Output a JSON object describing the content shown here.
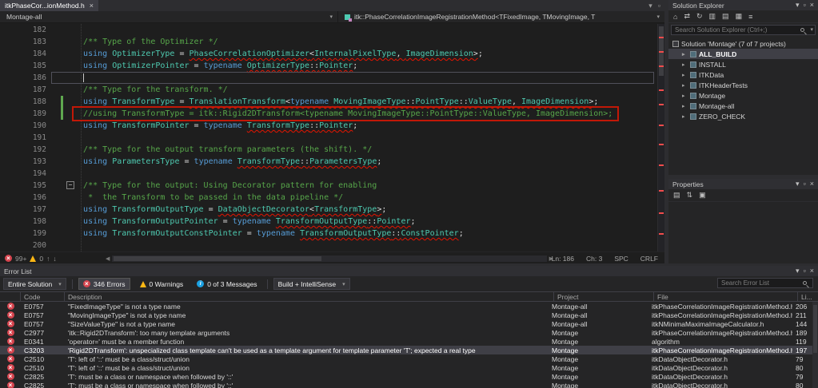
{
  "colors": {
    "error": "#D6444E",
    "warning": "#FDB714",
    "info": "#1BA1E2",
    "comment": "#57A64A",
    "keyword": "#569CD6",
    "type": "#4EC9B0",
    "change_bar": "#5FA84F",
    "annotation_box": "#C21807",
    "selection": "#3F3F46"
  },
  "icons": {
    "close": "×",
    "chevron_down": "▾",
    "chevron_left": "◀",
    "chevron_right": "▶",
    "expander": "▸",
    "up": "↑",
    "down": "↓",
    "minus": "−",
    "pin": "▫"
  },
  "editor": {
    "tab": {
      "title": "itkPhaseCor...ionMethod.h"
    },
    "navbar": {
      "project": "Montage-all",
      "scope": "itk::PhaseCorrelationImageRegistrationMethod<TFixedImage, TMovingImage, T"
    },
    "status": {
      "errors_badge": "99+",
      "warnings_badge": "0",
      "ln": "Ln: 186",
      "ch": "Ch: 3",
      "enc": "SPC",
      "eol": "CRLF"
    },
    "lines": [
      {
        "n": 182,
        "tokens": []
      },
      {
        "n": 183,
        "tokens": [
          {
            "t": "  ",
            "c": "pl"
          },
          {
            "t": "/** Type of the Optimizer */",
            "c": "cm"
          }
        ]
      },
      {
        "n": 184,
        "tokens": [
          {
            "t": "  ",
            "c": "pl"
          },
          {
            "t": "using",
            "c": "kw"
          },
          {
            "t": " ",
            "c": "pl"
          },
          {
            "t": "OptimizerType",
            "c": "ty"
          },
          {
            "t": " = ",
            "c": "pl"
          },
          {
            "t": "PhaseCorrelationOptimizer",
            "c": "ty sq"
          },
          {
            "t": "<",
            "c": "pl sq"
          },
          {
            "t": "InternalPixelType",
            "c": "ty sq"
          },
          {
            "t": ", ",
            "c": "pl sq"
          },
          {
            "t": "ImageDimension",
            "c": "ty sq"
          },
          {
            "t": ">",
            "c": "pl sq"
          },
          {
            "t": ";",
            "c": "pl"
          }
        ]
      },
      {
        "n": 185,
        "tokens": [
          {
            "t": "  ",
            "c": "pl"
          },
          {
            "t": "using",
            "c": "kw"
          },
          {
            "t": " ",
            "c": "pl"
          },
          {
            "t": "OptimizerPointer",
            "c": "ty"
          },
          {
            "t": " = ",
            "c": "pl"
          },
          {
            "t": "typename",
            "c": "kw"
          },
          {
            "t": " ",
            "c": "pl"
          },
          {
            "t": "OptimizerType",
            "c": "ty sq"
          },
          {
            "t": "::",
            "c": "pl sq"
          },
          {
            "t": "Pointer",
            "c": "ty sq"
          },
          {
            "t": ";",
            "c": "pl"
          }
        ]
      },
      {
        "n": 186,
        "current": true,
        "tokens": [
          {
            "t": "  ",
            "c": "pl"
          }
        ]
      },
      {
        "n": 187,
        "tokens": [
          {
            "t": "  ",
            "c": "pl"
          },
          {
            "t": "/** Type for the transform. */",
            "c": "cm"
          }
        ]
      },
      {
        "n": 188,
        "changed": true,
        "tokens": [
          {
            "t": "  ",
            "c": "pl"
          },
          {
            "t": "using",
            "c": "kw"
          },
          {
            "t": " ",
            "c": "pl"
          },
          {
            "t": "TransformType",
            "c": "ty"
          },
          {
            "t": " = ",
            "c": "pl"
          },
          {
            "t": "TranslationTransform",
            "c": "ty sq"
          },
          {
            "t": "<",
            "c": "pl sq"
          },
          {
            "t": "typename",
            "c": "kw sq"
          },
          {
            "t": " ",
            "c": "pl sq"
          },
          {
            "t": "MovingImageType",
            "c": "ty sq"
          },
          {
            "t": "::",
            "c": "pl sq"
          },
          {
            "t": "PointType",
            "c": "ty sq"
          },
          {
            "t": "::",
            "c": "pl sq"
          },
          {
            "t": "ValueType",
            "c": "ty sq"
          },
          {
            "t": ", ",
            "c": "pl sq"
          },
          {
            "t": "ImageDimension",
            "c": "ty sq"
          },
          {
            "t": ">",
            "c": "pl sq"
          },
          {
            "t": ";",
            "c": "pl"
          }
        ]
      },
      {
        "n": 189,
        "changed": true,
        "redbox": true,
        "tokens": [
          {
            "t": "  ",
            "c": "pl"
          },
          {
            "t": "//using TransformType = itk::Rigid2DTransform<typename MovingImageType::PointType::ValueType, ImageDimension>;",
            "c": "cm"
          }
        ]
      },
      {
        "n": 190,
        "tokens": [
          {
            "t": "  ",
            "c": "pl"
          },
          {
            "t": "using",
            "c": "kw"
          },
          {
            "t": " ",
            "c": "pl"
          },
          {
            "t": "TransformPointer",
            "c": "ty"
          },
          {
            "t": " = ",
            "c": "pl"
          },
          {
            "t": "typename",
            "c": "kw"
          },
          {
            "t": " ",
            "c": "pl"
          },
          {
            "t": "TransformType",
            "c": "ty sq"
          },
          {
            "t": "::",
            "c": "pl sq"
          },
          {
            "t": "Pointer",
            "c": "ty sq"
          },
          {
            "t": ";",
            "c": "pl"
          }
        ]
      },
      {
        "n": 191,
        "tokens": []
      },
      {
        "n": 192,
        "tokens": [
          {
            "t": "  ",
            "c": "pl"
          },
          {
            "t": "/** Type for the output transform parameters (the shift). */",
            "c": "cm"
          }
        ]
      },
      {
        "n": 193,
        "tokens": [
          {
            "t": "  ",
            "c": "pl"
          },
          {
            "t": "using",
            "c": "kw"
          },
          {
            "t": " ",
            "c": "pl"
          },
          {
            "t": "ParametersType",
            "c": "ty"
          },
          {
            "t": " = ",
            "c": "pl"
          },
          {
            "t": "typename",
            "c": "kw"
          },
          {
            "t": " ",
            "c": "pl"
          },
          {
            "t": "TransformType",
            "c": "ty sq"
          },
          {
            "t": "::",
            "c": "pl sq"
          },
          {
            "t": "ParametersType",
            "c": "ty sq"
          },
          {
            "t": ";",
            "c": "pl"
          }
        ]
      },
      {
        "n": 194,
        "tokens": []
      },
      {
        "n": 195,
        "fold": true,
        "tokens": [
          {
            "t": "  ",
            "c": "pl"
          },
          {
            "t": "/** Type for the output: Using Decorator pattern for enabling",
            "c": "cm"
          }
        ]
      },
      {
        "n": 196,
        "tokens": [
          {
            "t": "  ",
            "c": "pl"
          },
          {
            "t": " *  the Transform to be passed in the data pipeline */",
            "c": "cm"
          }
        ]
      },
      {
        "n": 197,
        "tokens": [
          {
            "t": "  ",
            "c": "pl"
          },
          {
            "t": "using",
            "c": "kw"
          },
          {
            "t": " ",
            "c": "pl"
          },
          {
            "t": "TransformOutputType",
            "c": "ty"
          },
          {
            "t": " = ",
            "c": "pl"
          },
          {
            "t": "DataObjectDecorator",
            "c": "ty sq"
          },
          {
            "t": "<",
            "c": "pl sq"
          },
          {
            "t": "TransformType",
            "c": "ty sq"
          },
          {
            "t": ">",
            "c": "pl sq"
          },
          {
            "t": ";",
            "c": "pl"
          }
        ]
      },
      {
        "n": 198,
        "tokens": [
          {
            "t": "  ",
            "c": "pl"
          },
          {
            "t": "using",
            "c": "kw"
          },
          {
            "t": " ",
            "c": "pl"
          },
          {
            "t": "TransformOutputPointer",
            "c": "ty"
          },
          {
            "t": " = ",
            "c": "pl"
          },
          {
            "t": "typename",
            "c": "kw"
          },
          {
            "t": " ",
            "c": "pl"
          },
          {
            "t": "TransformOutputType",
            "c": "ty sq"
          },
          {
            "t": "::",
            "c": "pl sq"
          },
          {
            "t": "Pointer",
            "c": "ty sq"
          },
          {
            "t": ";",
            "c": "pl"
          }
        ]
      },
      {
        "n": 199,
        "tokens": [
          {
            "t": "  ",
            "c": "pl"
          },
          {
            "t": "using",
            "c": "kw"
          },
          {
            "t": " ",
            "c": "pl"
          },
          {
            "t": "TransformOutputConstPointer",
            "c": "ty"
          },
          {
            "t": " = ",
            "c": "pl"
          },
          {
            "t": "typename",
            "c": "kw"
          },
          {
            "t": " ",
            "c": "pl"
          },
          {
            "t": "TransformOutputType",
            "c": "ty sq"
          },
          {
            "t": "::",
            "c": "pl sq"
          },
          {
            "t": "ConstPointer",
            "c": "ty sq"
          },
          {
            "t": ";",
            "c": "pl"
          }
        ]
      },
      {
        "n": 200,
        "tokens": []
      }
    ]
  },
  "solution_explorer": {
    "title": "Solution Explorer",
    "search_placeholder": "Search Solution Explorer (Ctrl+;)",
    "root": "Solution 'Montage' (7 of 7 projects)",
    "title_icons": [
      {
        "name": "window-position-icon",
        "glyph": "▾"
      },
      {
        "name": "pin-icon",
        "glyph": "▫"
      },
      {
        "name": "close-icon",
        "glyph": "×"
      }
    ],
    "toolbar_icons": [
      {
        "name": "home-icon",
        "glyph": "⌂"
      },
      {
        "name": "sync-with-active-document-icon",
        "glyph": "⇄"
      },
      {
        "name": "refresh-icon",
        "glyph": "↻"
      },
      {
        "name": "show-all-files-icon",
        "glyph": "▥"
      },
      {
        "name": "collapse-all-icon",
        "glyph": "▤"
      },
      {
        "name": "properties-icon",
        "glyph": "▦"
      },
      {
        "name": "menu-icon",
        "glyph": "≡"
      }
    ],
    "items": [
      {
        "label": "ALL_BUILD",
        "selected": true,
        "bold": true
      },
      {
        "label": "INSTALL"
      },
      {
        "label": "ITKData"
      },
      {
        "label": "ITKHeaderTests"
      },
      {
        "label": "Montage"
      },
      {
        "label": "Montage-all"
      },
      {
        "label": "ZERO_CHECK"
      }
    ]
  },
  "properties": {
    "title": "Properties",
    "title_icons": [
      {
        "name": "window-position-icon",
        "glyph": "▾"
      },
      {
        "name": "pin-icon",
        "glyph": "▫"
      },
      {
        "name": "close-icon",
        "glyph": "×"
      }
    ],
    "toolbar_icons": [
      {
        "name": "categorized-icon",
        "glyph": "▤"
      },
      {
        "name": "alphabetical-icon",
        "glyph": "⇅"
      },
      {
        "name": "property-pages-icon",
        "glyph": "▣"
      }
    ]
  },
  "error_list": {
    "title": "Error List",
    "title_icons": [
      {
        "name": "window-position-icon",
        "glyph": "▾"
      },
      {
        "name": "pin-icon",
        "glyph": "▫"
      },
      {
        "name": "close-icon",
        "glyph": "×"
      }
    ],
    "scope_dropdown": "Entire Solution",
    "errors_label": "346 Errors",
    "warnings_label": "0 Warnings",
    "messages_label": "0 of 3 Messages",
    "source_dropdown": "Build + IntelliSense",
    "search_placeholder": "Search Error List",
    "columns": [
      "",
      "Code",
      "Description",
      "Project",
      "File",
      "Li..."
    ],
    "rows": [
      {
        "code": "E0757",
        "description": "\"FixedImageType\" is not a type name",
        "project": "Montage-all",
        "file": "itkPhaseCorrelationImageRegistrationMethod.h",
        "line": "206"
      },
      {
        "code": "E0757",
        "description": "\"MovingImageType\" is not a type name",
        "project": "Montage-all",
        "file": "itkPhaseCorrelationImageRegistrationMethod.h",
        "line": "211"
      },
      {
        "code": "E0757",
        "description": "\"SizeValueType\" is not a type name",
        "project": "Montage-all",
        "file": "itkNMinimaMaximaImageCalculator.h",
        "line": "144"
      },
      {
        "code": "C2977",
        "description": "'itk::Rigid2DTransform': too many template arguments",
        "project": "Montage",
        "file": "itkPhaseCorrelationImageRegistrationMethod.h",
        "line": "189"
      },
      {
        "code": "E0341",
        "description": "'operator=' must be a member function",
        "project": "Montage",
        "file": "algorithm",
        "line": "119"
      },
      {
        "code": "C3203",
        "description": "'Rigid2DTransform': unspecialized class template can't be used as a template argument for template parameter 'T'; expected a real type",
        "project": "Montage",
        "file": "itkPhaseCorrelationImageRegistrationMethod.h",
        "line": "197",
        "selected": true
      },
      {
        "code": "C2510",
        "description": "'T': left of '::' must be a class/struct/union",
        "project": "Montage",
        "file": "itkDataObjectDecorator.h",
        "line": "79"
      },
      {
        "code": "C2510",
        "description": "'T': left of '::' must be a class/struct/union",
        "project": "Montage",
        "file": "itkDataObjectDecorator.h",
        "line": "80"
      },
      {
        "code": "C2825",
        "description": "'T': must be a class or namespace when followed by '::'",
        "project": "Montage",
        "file": "itkDataObjectDecorator.h",
        "line": "79"
      },
      {
        "code": "C2825",
        "description": "'T': must be a class or namespace when followed by '::'",
        "project": "Montage",
        "file": "itkDataObjectDecorator.h",
        "line": "80"
      }
    ]
  }
}
